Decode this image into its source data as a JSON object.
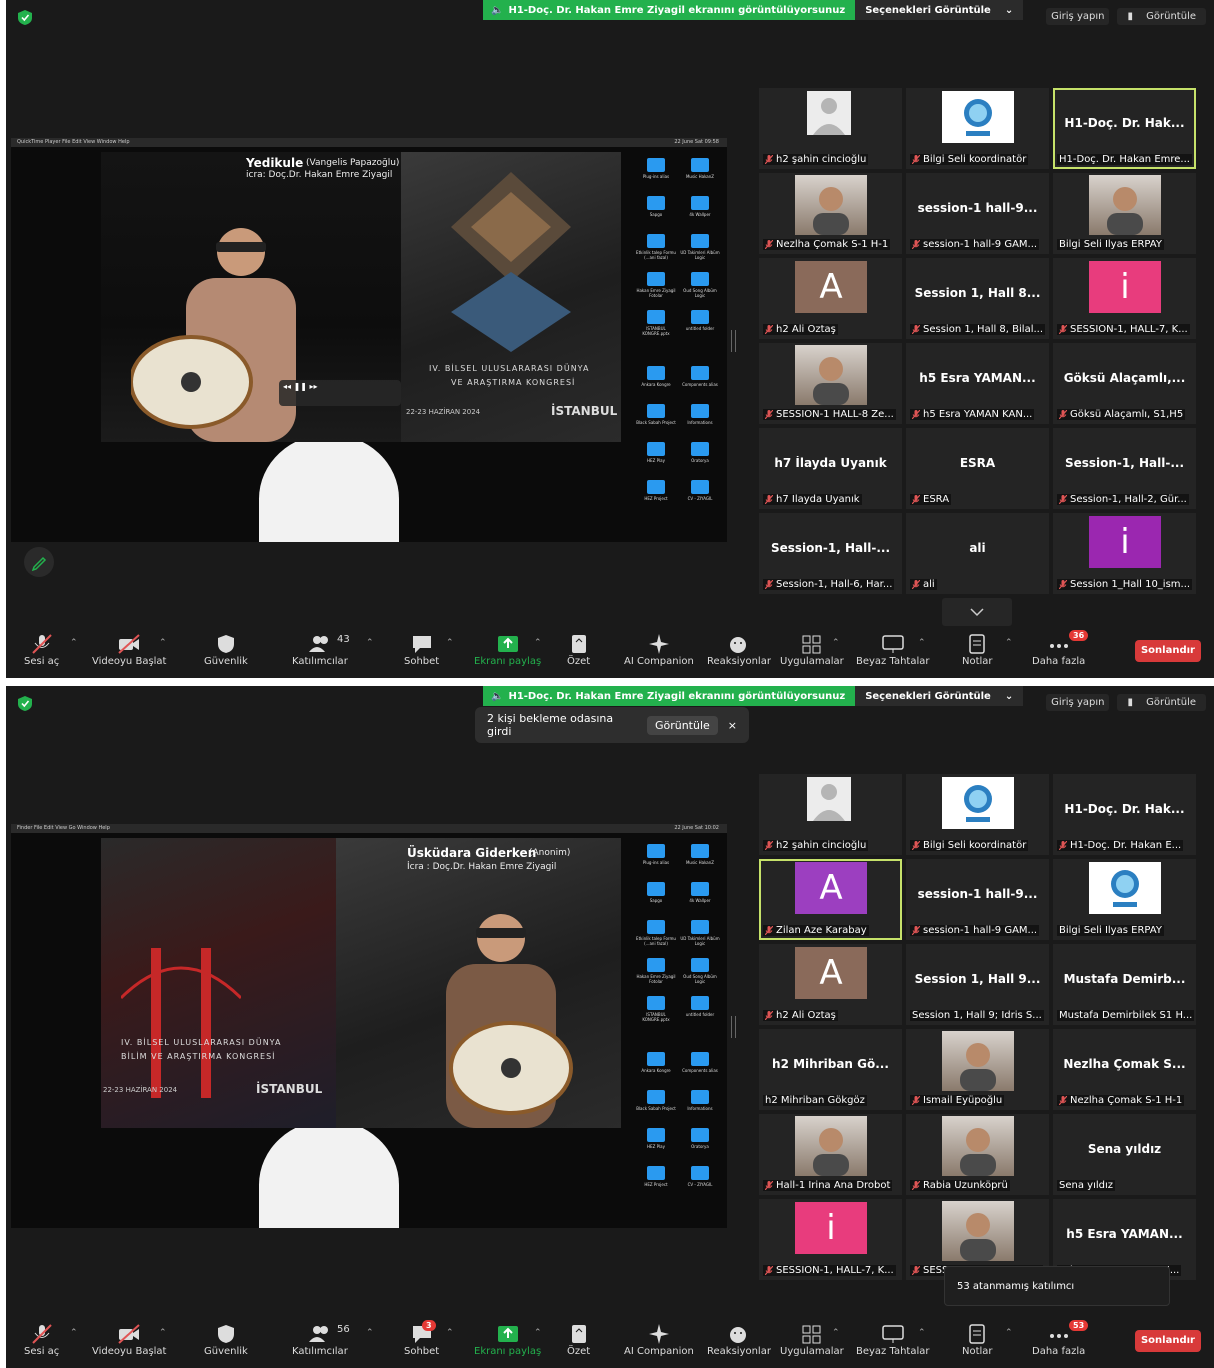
{
  "banner": {
    "sharing_text": "H1-Doç. Dr. Hakan Emre Ziyagil ekranını görüntülüyorsunuz",
    "view_options": "Seçenekleri Görüntüle"
  },
  "top_right": {
    "login": "Giriş yapın",
    "view": "Görüntüle"
  },
  "toolbar": {
    "mute": "Sesi aç",
    "video": "Videoyu Başlat",
    "security": "Güvenlik",
    "participants": "Katılımcılar",
    "chat": "Sohbet",
    "share": "Ekranı paylaş",
    "summary": "Özet",
    "ai": "AI Companion",
    "reactions": "Reaksiyonlar",
    "apps": "Uygulamalar",
    "whiteboard": "Beyaz Tahtalar",
    "notes": "Notlar",
    "more": "Daha fazla",
    "end": "Sonlandır"
  },
  "colors": {
    "banner_green": "#23b14d",
    "highlight": "#c6e26a",
    "end_red": "#d83a3a"
  },
  "desktop_icons": [
    "Plug-ins alias",
    "Music HakanZ",
    "Sapgo",
    "4k Wallper",
    "Etkinlik talep Formu (...ani fazal)",
    "UD Takimleri Albüm Logic",
    "Hakan Emre Ziyagil Fotolar",
    "Oud Song Albüm Logic",
    "ISTANBUL KONGRE.pptx",
    "untitled folder",
    "Ankara Kongre",
    "Components alias",
    "Black Sabah Project",
    "Informations",
    "HEZ Play",
    "Oratorya",
    "HEZ Project",
    "CV - ZIYAGIL"
  ],
  "screens": [
    {
      "mac_menu": "QuickTime Player   File   Edit   View   Window   Help",
      "mac_clock": "22 June Sat 09:58",
      "video_title": "Yedikule",
      "video_title_sub": "(Vangelis Papazoğlu)",
      "video_credit": "icra: Doç.Dr. Hakan Emre Ziyagil",
      "poster_line1": "IV. BİLSEL ULUSLARARASI DÜNYA",
      "poster_line2": "VE ARAŞTIRMA KONGRESİ",
      "poster_date": "22-23 HAZİRAN 2024",
      "poster_city": "İSTANBUL",
      "participants_count": "43",
      "more_badge": "36",
      "chat_badge": "",
      "notification": null,
      "tooltip": null,
      "tiles": [
        {
          "type": "avatar-gray",
          "label": "h2 şahin cincioğlu",
          "muted": true
        },
        {
          "type": "logo",
          "label": "Bilgi Seli koordinatör",
          "muted": true
        },
        {
          "type": "name",
          "name": "H1-Doç. Dr. Hak...",
          "label": "H1-Doç. Dr. Hakan Emre...",
          "muted": false,
          "highlight": true
        },
        {
          "type": "video",
          "label": "Nezlha Çomak S-1 H-1",
          "muted": true
        },
        {
          "type": "name",
          "name": "session-1 hall-9...",
          "label": "session-1 hall-9 GAM...",
          "muted": true
        },
        {
          "type": "video",
          "label": "Bilgi Seli İlyas ERPAY",
          "muted": false
        },
        {
          "type": "letter",
          "letter": "A",
          "color": "#8a6a5a",
          "label": "h2 Ali Öztaş",
          "muted": true
        },
        {
          "type": "name",
          "name": "Session 1, Hall 8...",
          "label": "Session 1, Hall 8, Bilal...",
          "muted": true
        },
        {
          "type": "letter",
          "letter": "i",
          "color": "#e83c7d",
          "label": "SESSION-1, HALL-7, K...",
          "muted": true
        },
        {
          "type": "video",
          "label": "SESSION-1 HALL-8 Ze...",
          "muted": true
        },
        {
          "type": "name",
          "name": "h5 Esra YAMAN...",
          "label": "h5 Esra YAMAN KAN...",
          "muted": true
        },
        {
          "type": "name",
          "name": "Göksü Alaçamlı,...",
          "label": "Göksü Alaçamlı, S1,H5",
          "muted": true
        },
        {
          "type": "name",
          "name": "h7 İlayda Uyanık",
          "label": "h7 İlayda Uyanık",
          "muted": true
        },
        {
          "type": "name",
          "name": "ESRA",
          "label": "ESRA",
          "muted": true
        },
        {
          "type": "name",
          "name": "Session-1, Hall-...",
          "label": "Session-1, Hall-2, Gür...",
          "muted": true
        },
        {
          "type": "name",
          "name": "Session-1, Hall-...",
          "label": "Session-1, Hall-6, Har...",
          "muted": true
        },
        {
          "type": "name",
          "name": "ali",
          "label": "ali",
          "muted": true
        },
        {
          "type": "letter",
          "letter": "i",
          "color": "#9b27b0",
          "label": "Session 1_Hall 10_ism...",
          "muted": true
        }
      ]
    },
    {
      "mac_menu": "Finder   File   Edit   View   Go   Window   Help",
      "mac_clock": "22 June Sat 10:02",
      "video_title": "Üsküdara Giderken",
      "video_title_sub": "(Anonim)",
      "video_credit": "İcra : Doç.Dr. Hakan Emre Ziyagil",
      "poster_line1": "IV. BİLSEL ULUSLARARASI DÜNYA",
      "poster_line2": "BİLİM VE ARAŞTIRMA KONGRESİ",
      "poster_date": "22-23 HAZİRAN 2024",
      "poster_city": "İSTANBUL",
      "participants_count": "56",
      "more_badge": "53",
      "chat_badge": "3",
      "notification": {
        "text": "2 kişi bekleme odasına girdi",
        "button": "Görüntüle",
        "close": "×"
      },
      "tooltip": "53 atanmamış katılımcı",
      "tiles": [
        {
          "type": "avatar-gray",
          "label": "h2 şahin cincioğlu",
          "muted": true
        },
        {
          "type": "logo",
          "label": "Bilgi Seli koordinatör",
          "muted": true
        },
        {
          "type": "name",
          "name": "H1-Doç. Dr. Hak...",
          "label": "H1-Doç. Dr. Hakan E...",
          "muted": true
        },
        {
          "type": "letter",
          "letter": "A",
          "color": "#9c3fc0",
          "label": "Zilan Aze Karabay",
          "muted": true,
          "highlight": true
        },
        {
          "type": "name",
          "name": "session-1 hall-9...",
          "label": "session-1 hall-9 GAM...",
          "muted": true
        },
        {
          "type": "logo",
          "label": "Bilgi Seli İlyas ERPAY",
          "muted": false
        },
        {
          "type": "letter",
          "letter": "A",
          "color": "#8a6a5a",
          "label": "h2 Ali Öztaş",
          "muted": true
        },
        {
          "type": "name",
          "name": "Session 1, Hall 9...",
          "label": "Session 1, Hall 9; İdris S...",
          "muted": false
        },
        {
          "type": "name",
          "name": "Mustafa Demirb...",
          "label": "Mustafa Demirbilek S1 H...",
          "muted": false
        },
        {
          "type": "name",
          "name": "h2 Mihriban Gö...",
          "label": "h2 Mihriban Gökgöz",
          "muted": false
        },
        {
          "type": "video",
          "label": "İsmail Eyüpoğlu",
          "muted": true
        },
        {
          "type": "name",
          "name": "Nezlha Çomak S...",
          "label": "Nezlha Çomak S-1 H-1",
          "muted": true
        },
        {
          "type": "video",
          "label": "Hall-1 Irina Ana Drobot",
          "muted": true
        },
        {
          "type": "video",
          "label": "Rabia Uzunköprü",
          "muted": true
        },
        {
          "type": "name",
          "name": "Sena yıldız",
          "label": "Sena yıldız",
          "muted": false
        },
        {
          "type": "letter",
          "letter": "i",
          "color": "#e83c7d",
          "label": "SESSION-1, HALL-7, K...",
          "muted": true
        },
        {
          "type": "video",
          "label": "SESSION-1 HALL-8 Ze...",
          "muted": true
        },
        {
          "type": "name",
          "name": "h5 Esra YAMAN...",
          "label": "h5 Esra YAMAN KAN...",
          "muted": true
        }
      ]
    }
  ]
}
